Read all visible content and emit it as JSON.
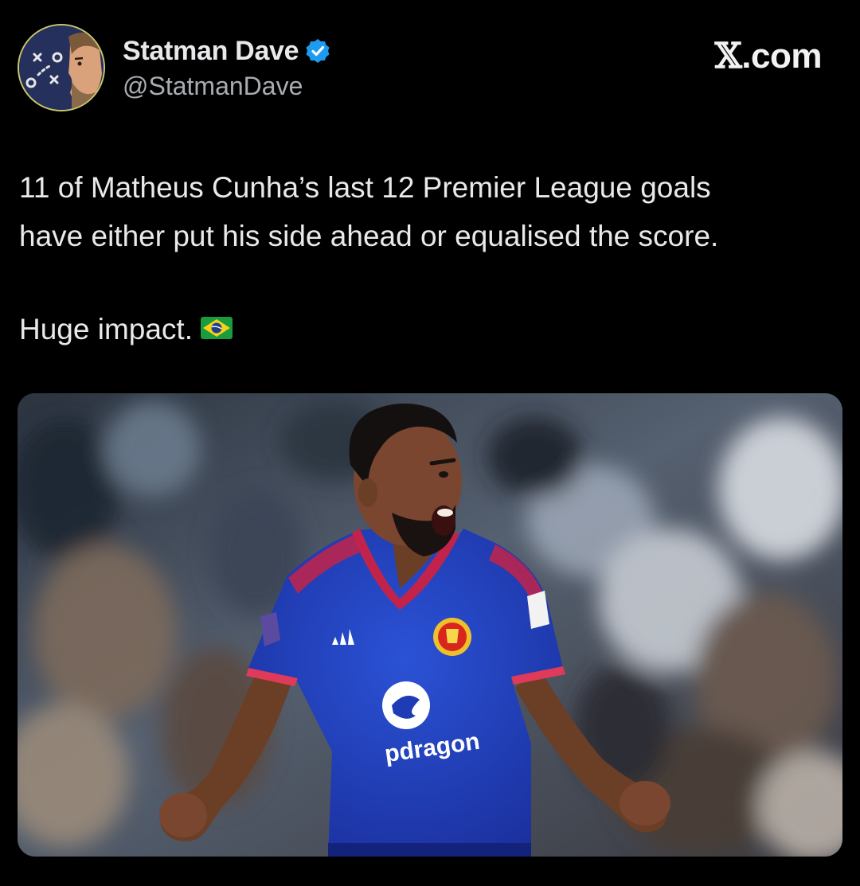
{
  "author": {
    "display_name": "Statman Dave",
    "handle": "@StatmanDave",
    "verified": true,
    "avatar_icon": "tactics-board-avatar-icon"
  },
  "brand": {
    "label_x": "𝕏",
    "label_rest": ".com"
  },
  "tweet": {
    "line1": "11 of Matheus Cunha’s last 12 Premier League goals",
    "line2": "have either put his side ahead or equalised the score.",
    "line3": "Huge impact.",
    "emoji": "brazil-flag-icon"
  },
  "media": {
    "shirt_sponsor": "Snapdragon",
    "shirt_sponsor_visible": "pdragon",
    "image_icon": "football-player-celebrating-photo"
  },
  "colors": {
    "background": "#000000",
    "text": "#e7e9ea",
    "handle": "#a8adb3",
    "verified": "#1d9bf0",
    "avatar_bg": "#25305c",
    "avatar_ring": "#c9c86a",
    "kit_blue": "#1f3bb5",
    "kit_trim": "#c2234a"
  }
}
